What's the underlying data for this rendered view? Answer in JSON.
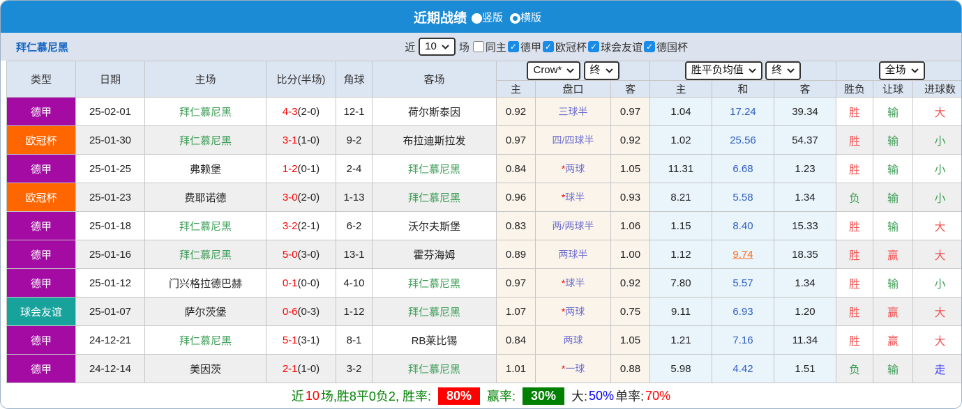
{
  "colors": {
    "header_blue": "#1b8bd5",
    "filter_bg": "#dde3ee",
    "team_link_blue": "#1565c0",
    "table_header_bg": "#dce5f2",
    "badge_purple": "#a30ba3",
    "badge_orange": "#ff6600",
    "badge_teal": "#17a29c",
    "cream": "#faf4ea",
    "lightblue": "#e9f4fb",
    "alt_gray": "#efefef",
    "checkbox_blue": "#1a8ce8",
    "team_green": "#3e9e57",
    "score_red": "#ff0000",
    "handicap_blue": "#6f6fcf",
    "avg_blue": "#3060c0",
    "orange_hl": "#ff6a1a",
    "result_red": "#f35555",
    "result_blue": "#4444ff",
    "summary_green": "#008000"
  },
  "header": {
    "title": "近期战绩",
    "radios": [
      {
        "label": "竖版",
        "checked": false
      },
      {
        "label": "横版",
        "checked": true
      }
    ]
  },
  "filter": {
    "team_name": "拜仁慕尼黑",
    "near_label": "近",
    "count_value": "10",
    "games_label": "场",
    "checks": [
      {
        "label": "同主",
        "checked": false
      },
      {
        "label": "德甲",
        "checked": true
      },
      {
        "label": "欧冠杯",
        "checked": true
      },
      {
        "label": "球会友谊",
        "checked": true
      },
      {
        "label": "德国杯",
        "checked": true
      }
    ]
  },
  "table": {
    "header": {
      "cols": [
        "类型",
        "日期",
        "主场",
        "比分(半场)",
        "角球",
        "客场"
      ],
      "group1": {
        "source_select": "Crow*",
        "period_select": "终",
        "sub": [
          "主",
          "盘口",
          "客"
        ]
      },
      "group2": {
        "avg_select": "胜平负均值",
        "period_select": "终",
        "sub": [
          "主",
          "和",
          "客"
        ]
      },
      "group3": {
        "scope_select": "全场",
        "sub": [
          "胜负",
          "让球",
          "进球数"
        ]
      }
    },
    "rows": [
      {
        "type": {
          "label": "德甲",
          "color": "purple"
        },
        "date": "25-02-01",
        "home": {
          "name": "拜仁慕尼黑",
          "green": true
        },
        "score": {
          "full": "4-3",
          "half": "(2-0)"
        },
        "corner": "12-1",
        "away": {
          "name": "荷尔斯泰因",
          "green": false
        },
        "odds": {
          "home": "0.92",
          "handicap": "三球半",
          "away": "0.97"
        },
        "avg": {
          "win": "1.04",
          "draw": "17.24",
          "lose": "39.34",
          "draw_hl": false
        },
        "results": [
          {
            "text": "胜",
            "color": "red"
          },
          {
            "text": "输",
            "color": "green"
          },
          {
            "text": "大",
            "color": "red"
          }
        ]
      },
      {
        "type": {
          "label": "欧冠杯",
          "color": "orange"
        },
        "date": "25-01-30",
        "home": {
          "name": "拜仁慕尼黑",
          "green": true
        },
        "score": {
          "full": "3-1",
          "half": "(1-0)"
        },
        "corner": "9-2",
        "away": {
          "name": "布拉迪斯拉发",
          "green": false
        },
        "odds": {
          "home": "0.97",
          "handicap": "四/四球半",
          "away": "0.92"
        },
        "avg": {
          "win": "1.02",
          "draw": "25.56",
          "lose": "54.37",
          "draw_hl": false
        },
        "results": [
          {
            "text": "胜",
            "color": "red"
          },
          {
            "text": "输",
            "color": "green"
          },
          {
            "text": "小",
            "color": "green"
          }
        ]
      },
      {
        "type": {
          "label": "德甲",
          "color": "purple"
        },
        "date": "25-01-25",
        "home": {
          "name": "弗赖堡",
          "green": false
        },
        "score": {
          "full": "1-2",
          "half": "(0-1)"
        },
        "corner": "2-4",
        "away": {
          "name": "拜仁慕尼黑",
          "green": true
        },
        "odds": {
          "home": "0.84",
          "handicap": "*两球",
          "away": "1.05"
        },
        "avg": {
          "win": "11.31",
          "draw": "6.68",
          "lose": "1.23",
          "draw_hl": false
        },
        "results": [
          {
            "text": "胜",
            "color": "red"
          },
          {
            "text": "输",
            "color": "green"
          },
          {
            "text": "小",
            "color": "green"
          }
        ]
      },
      {
        "type": {
          "label": "欧冠杯",
          "color": "orange"
        },
        "date": "25-01-23",
        "home": {
          "name": "费耶诺德",
          "green": false
        },
        "score": {
          "full": "3-0",
          "half": "(2-0)"
        },
        "corner": "1-13",
        "away": {
          "name": "拜仁慕尼黑",
          "green": true
        },
        "odds": {
          "home": "0.96",
          "handicap": "*球半",
          "away": "0.93"
        },
        "avg": {
          "win": "8.21",
          "draw": "5.58",
          "lose": "1.34",
          "draw_hl": false
        },
        "results": [
          {
            "text": "负",
            "color": "green"
          },
          {
            "text": "输",
            "color": "green"
          },
          {
            "text": "小",
            "color": "green"
          }
        ]
      },
      {
        "type": {
          "label": "德甲",
          "color": "purple"
        },
        "date": "25-01-18",
        "home": {
          "name": "拜仁慕尼黑",
          "green": true
        },
        "score": {
          "full": "3-2",
          "half": "(2-1)"
        },
        "corner": "6-2",
        "away": {
          "name": "沃尔夫斯堡",
          "green": false
        },
        "odds": {
          "home": "0.83",
          "handicap": "两/两球半",
          "away": "1.06"
        },
        "avg": {
          "win": "1.15",
          "draw": "8.40",
          "lose": "15.33",
          "draw_hl": false
        },
        "results": [
          {
            "text": "胜",
            "color": "red"
          },
          {
            "text": "输",
            "color": "green"
          },
          {
            "text": "大",
            "color": "red"
          }
        ]
      },
      {
        "type": {
          "label": "德甲",
          "color": "purple"
        },
        "date": "25-01-16",
        "home": {
          "name": "拜仁慕尼黑",
          "green": true
        },
        "score": {
          "full": "5-0",
          "half": "(3-0)"
        },
        "corner": "13-1",
        "away": {
          "name": "霍芬海姆",
          "green": false
        },
        "odds": {
          "home": "0.89",
          "handicap": "两球半",
          "away": "1.00"
        },
        "avg": {
          "win": "1.12",
          "draw": "9.74",
          "lose": "18.35",
          "draw_hl": true
        },
        "results": [
          {
            "text": "胜",
            "color": "red"
          },
          {
            "text": "赢",
            "color": "red"
          },
          {
            "text": "大",
            "color": "red"
          }
        ]
      },
      {
        "type": {
          "label": "德甲",
          "color": "purple"
        },
        "date": "25-01-12",
        "home": {
          "name": "门兴格拉德巴赫",
          "green": false
        },
        "score": {
          "full": "0-1",
          "half": "(0-0)"
        },
        "corner": "4-10",
        "away": {
          "name": "拜仁慕尼黑",
          "green": true
        },
        "odds": {
          "home": "0.97",
          "handicap": "*球半",
          "away": "0.92"
        },
        "avg": {
          "win": "7.80",
          "draw": "5.57",
          "lose": "1.34",
          "draw_hl": false
        },
        "results": [
          {
            "text": "胜",
            "color": "red"
          },
          {
            "text": "输",
            "color": "green"
          },
          {
            "text": "小",
            "color": "green"
          }
        ]
      },
      {
        "type": {
          "label": "球会友谊",
          "color": "teal"
        },
        "date": "25-01-07",
        "home": {
          "name": "萨尔茨堡",
          "green": false
        },
        "score": {
          "full": "0-6",
          "half": "(0-3)"
        },
        "corner": "1-12",
        "away": {
          "name": "拜仁慕尼黑",
          "green": true
        },
        "odds": {
          "home": "1.07",
          "handicap": "*两球",
          "away": "0.75"
        },
        "avg": {
          "win": "9.11",
          "draw": "6.93",
          "lose": "1.20",
          "draw_hl": false
        },
        "results": [
          {
            "text": "胜",
            "color": "red"
          },
          {
            "text": "赢",
            "color": "red"
          },
          {
            "text": "大",
            "color": "red"
          }
        ]
      },
      {
        "type": {
          "label": "德甲",
          "color": "purple"
        },
        "date": "24-12-21",
        "home": {
          "name": "拜仁慕尼黑",
          "green": true
        },
        "score": {
          "full": "5-1",
          "half": "(3-1)"
        },
        "corner": "8-1",
        "away": {
          "name": "RB莱比锡",
          "green": false
        },
        "odds": {
          "home": "0.84",
          "handicap": "两球",
          "away": "1.05"
        },
        "avg": {
          "win": "1.21",
          "draw": "7.16",
          "lose": "11.34",
          "draw_hl": false
        },
        "results": [
          {
            "text": "胜",
            "color": "red"
          },
          {
            "text": "赢",
            "color": "red"
          },
          {
            "text": "大",
            "color": "red"
          }
        ]
      },
      {
        "type": {
          "label": "德甲",
          "color": "purple"
        },
        "date": "24-12-14",
        "home": {
          "name": "美因茨",
          "green": false
        },
        "score": {
          "full": "2-1",
          "half": "(1-0)"
        },
        "corner": "3-2",
        "away": {
          "name": "拜仁慕尼黑",
          "green": true
        },
        "odds": {
          "home": "1.01",
          "handicap": "*一球",
          "away": "0.88"
        },
        "avg": {
          "win": "5.98",
          "draw": "4.42",
          "lose": "1.51",
          "draw_hl": false
        },
        "results": [
          {
            "text": "负",
            "color": "green"
          },
          {
            "text": "输",
            "color": "green"
          },
          {
            "text": "走",
            "color": "blue"
          }
        ]
      }
    ]
  },
  "summary": {
    "segments": [
      {
        "text": "近",
        "color": "green"
      },
      {
        "text": "10",
        "color": "red"
      },
      {
        "text": "场,胜8平0负2, 胜率:",
        "color": "green"
      },
      {
        "text": "80%",
        "badge": "red"
      },
      {
        "text": "赢率:",
        "color": "green"
      },
      {
        "text": "30%",
        "badge": "green"
      },
      {
        "text": "大:",
        "color": "dark"
      },
      {
        "text": "50%",
        "color": "blue"
      },
      {
        "text": " 单率:",
        "color": "dark"
      },
      {
        "text": "70%",
        "color": "red"
      }
    ]
  }
}
